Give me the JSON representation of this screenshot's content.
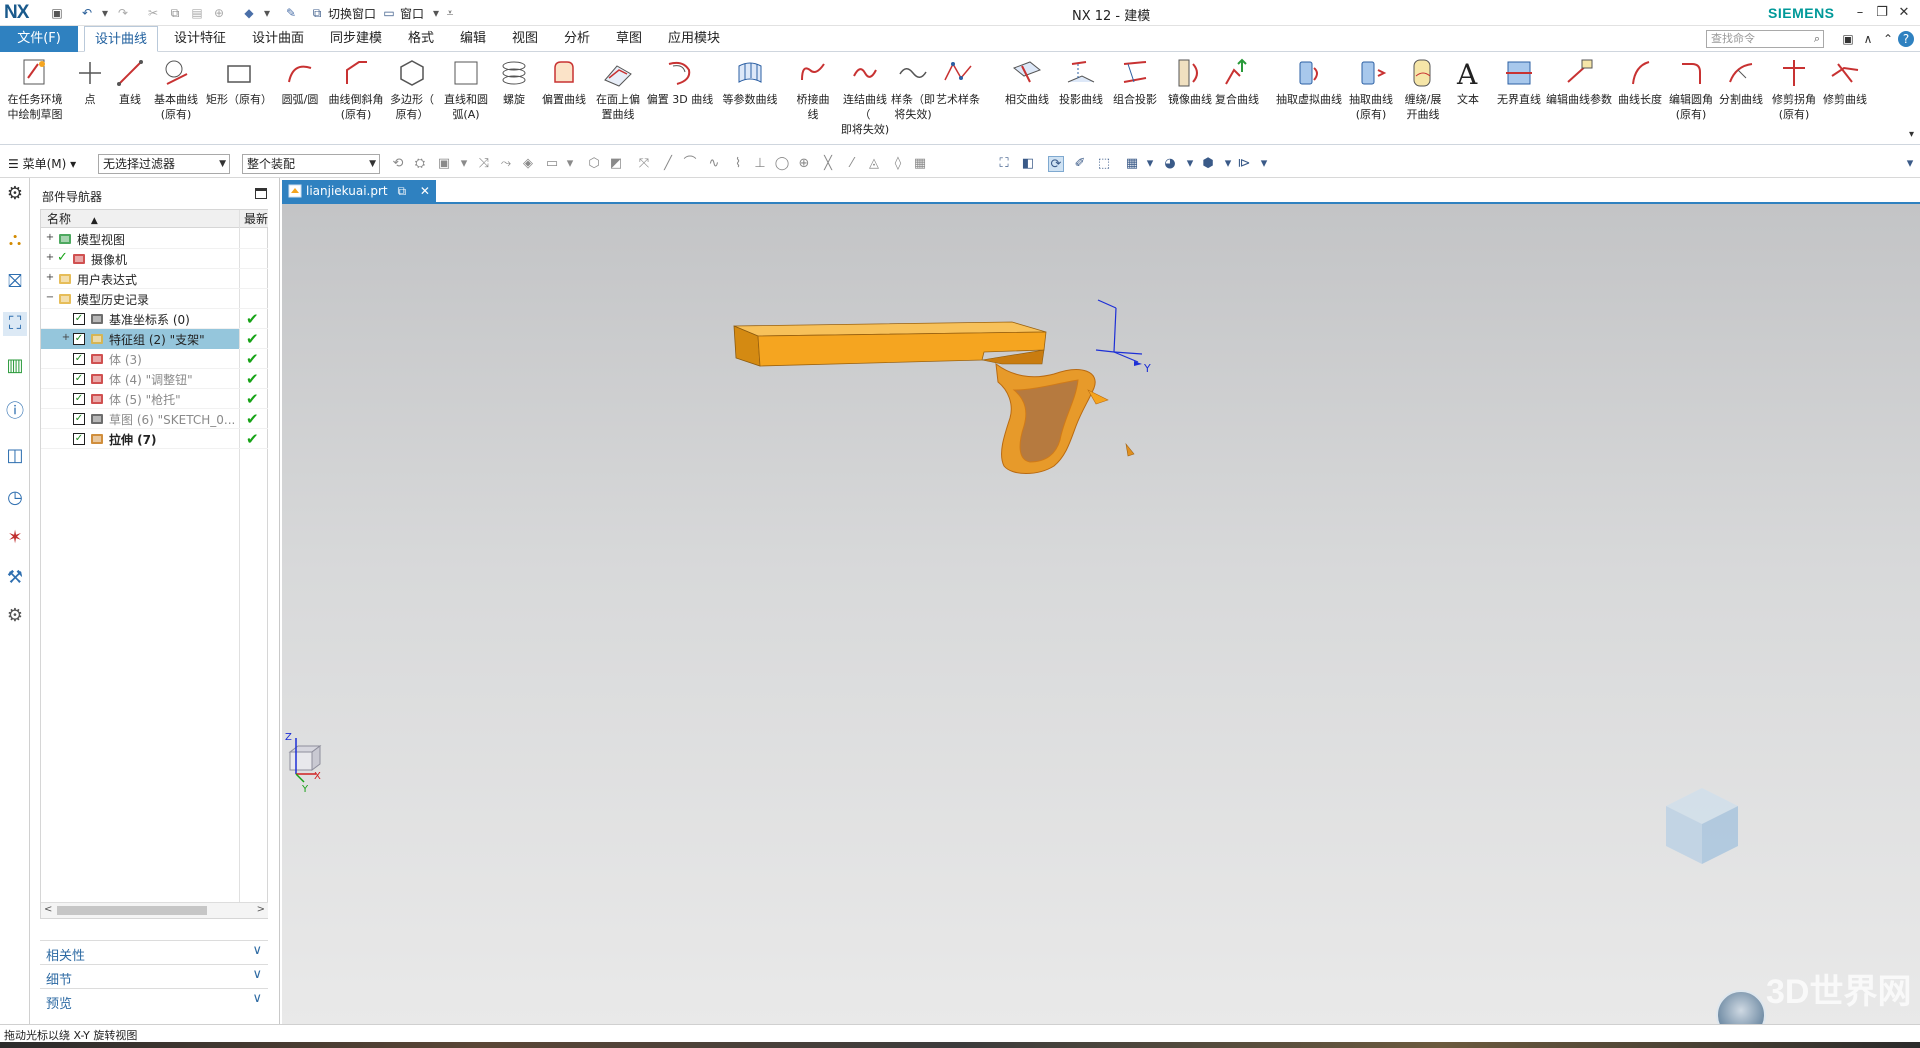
{
  "titlebar": {
    "logo": "NX",
    "switch_window": "切换窗口",
    "window_menu": "窗口",
    "title": "NX 12 - 建模",
    "brand": "SIEMENS"
  },
  "tabs": {
    "file": "文件(F)",
    "items": [
      "设计曲线",
      "设计特征",
      "设计曲面",
      "同步建模",
      "格式",
      "编辑",
      "视图",
      "分析",
      "草图",
      "应用模块"
    ],
    "active": "设计曲线",
    "search_placeholder": "查找命令"
  },
  "ribbon": {
    "buttons": [
      {
        "label": "在任务环境\n中绘制草图",
        "icon": "sketch-in-task-icon"
      },
      {
        "label": "点",
        "icon": "point-icon"
      },
      {
        "label": "直线",
        "icon": "line-icon"
      },
      {
        "label": "基本曲线\n(原有)",
        "icon": "basic-curves-icon"
      },
      {
        "label": "矩形（原有）",
        "icon": "rectangle-icon"
      },
      {
        "label": "圆弧/圆",
        "icon": "arc-icon"
      },
      {
        "label": "曲线倒斜角\n(原有)",
        "icon": "chamfer-curve-icon"
      },
      {
        "label": "多边形（\n原有）",
        "icon": "polygon-icon"
      },
      {
        "label": "直线和圆\n弧(A)",
        "icon": "lines-arcs-icon"
      },
      {
        "label": "螺旋",
        "icon": "helix-icon"
      },
      {
        "label": "偏置曲线",
        "icon": "offset-curve-icon"
      },
      {
        "label": "在面上偏\n置曲线",
        "icon": "offset-in-face-icon"
      },
      {
        "label": "偏置 3D 曲线",
        "icon": "offset-3d-icon"
      },
      {
        "label": "等参数曲线",
        "icon": "isoparametric-icon"
      },
      {
        "label": "桥接曲线",
        "icon": "bridge-curve-icon"
      },
      {
        "label": "连结曲线（\n即将失效)",
        "icon": "join-curve-icon"
      },
      {
        "label": "样条（即\n将失效)",
        "icon": "spline-icon"
      },
      {
        "label": "艺术样条",
        "icon": "studio-spline-icon"
      },
      {
        "label": "相交曲线",
        "icon": "intersection-curve-icon"
      },
      {
        "label": "投影曲线",
        "icon": "project-curve-icon"
      },
      {
        "label": "组合投影",
        "icon": "combined-projection-icon"
      },
      {
        "label": "镜像曲线",
        "icon": "mirror-curve-icon"
      },
      {
        "label": "复合曲线",
        "icon": "composite-curve-icon"
      },
      {
        "label": "抽取虚拟曲线",
        "icon": "extract-virtual-icon"
      },
      {
        "label": "抽取曲线\n(原有)",
        "icon": "extract-curve-icon"
      },
      {
        "label": "缠绕/展\n开曲线",
        "icon": "wrap-unwrap-icon"
      },
      {
        "label": "文本",
        "icon": "text-icon"
      },
      {
        "label": "无界直线",
        "icon": "unbounded-line-icon"
      },
      {
        "label": "编辑曲线参数",
        "icon": "edit-curve-params-icon"
      },
      {
        "label": "曲线长度",
        "icon": "curve-length-icon"
      },
      {
        "label": "编辑圆角\n(原有)",
        "icon": "edit-fillet-icon"
      },
      {
        "label": "分割曲线",
        "icon": "divide-curve-icon"
      },
      {
        "label": "修剪拐角\n(原有)",
        "icon": "trim-corner-icon"
      },
      {
        "label": "修剪曲线",
        "icon": "trim-curve-icon"
      }
    ]
  },
  "toolbar2": {
    "menu": "菜单(M)",
    "filter": "无选择过滤器",
    "assembly": "整个装配"
  },
  "navigator": {
    "title": "部件导航器",
    "col_name": "名称",
    "col_latest": "最新",
    "rows": [
      {
        "name": "模型视图",
        "icon": "model-views-icon",
        "style": "normal"
      },
      {
        "name": "摄像机",
        "icon": "camera-icon",
        "style": "normal"
      },
      {
        "name": "用户表达式",
        "icon": "folder-icon",
        "style": "normal"
      },
      {
        "name": "模型历史记录",
        "icon": "folder-open-icon",
        "style": "normal"
      },
      {
        "name": "基准坐标系 (0)",
        "icon": "datum-csys-icon",
        "style": "normal"
      },
      {
        "name": "特征组 (2) \"支架\"",
        "icon": "feature-group-icon",
        "style": "selected"
      },
      {
        "name": "体 (3)",
        "icon": "body-icon",
        "style": "dim"
      },
      {
        "name": "体 (4) \"调整钮\"",
        "icon": "body-icon",
        "style": "dim"
      },
      {
        "name": "体 (5) \"枪托\"",
        "icon": "body-icon",
        "style": "dim"
      },
      {
        "name": "草图 (6) \"SKETCH_0...",
        "icon": "sketch-icon",
        "style": "dim"
      },
      {
        "name": "拉伸 (7)",
        "icon": "extrude-icon",
        "style": "bold"
      }
    ],
    "panels": [
      "相关性",
      "细节",
      "预览"
    ]
  },
  "document": {
    "tab_name": "lianjiekuai.prt"
  },
  "viewport": {
    "triad_labels": {
      "z": "Z",
      "x": "X",
      "y": "Y"
    },
    "csys_label_y": "Y",
    "watermark": "3D世界网",
    "model_color": "#f5a520",
    "background_top": "#c3c4c6",
    "background_bottom": "#e9e9e9"
  },
  "status": {
    "text": "拖动光标以绕 X-Y 旋转视图"
  },
  "colors": {
    "accent": "#2f81c0",
    "check": "#17a317",
    "selection": "#95c6dc"
  }
}
